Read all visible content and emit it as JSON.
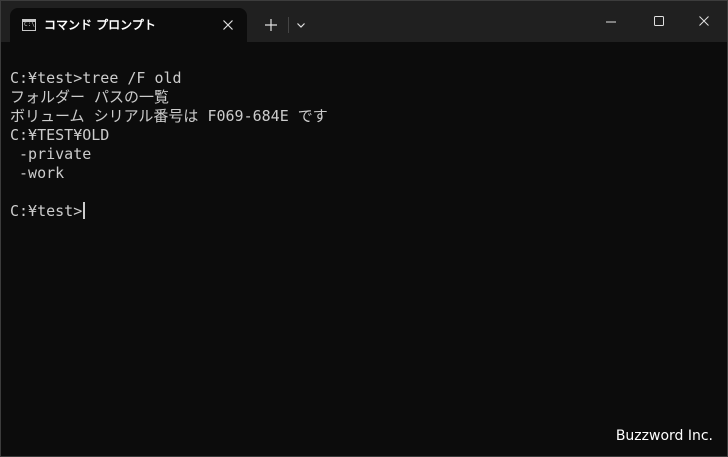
{
  "window": {
    "tab_title": "コマンド プロンプト",
    "icons": {
      "tab_icon": "command-prompt-icon",
      "tab_close": "close-icon",
      "new_tab": "plus-icon",
      "dropdown": "chevron-down-icon",
      "minimize": "minimize-icon",
      "maximize": "maximize-icon",
      "close": "close-icon"
    }
  },
  "terminal": {
    "lines": [
      "",
      "C:¥test>tree /F old",
      "フォルダー パスの一覧",
      "ボリューム シリアル番号は F069-684E です",
      "C:¥TEST¥OLD",
      " -private",
      " -work",
      ""
    ],
    "prompt": "C:¥test>"
  },
  "watermark": "Buzzword Inc.",
  "colors": {
    "titlebar": "#202020",
    "background": "#0c0c0c",
    "text": "#cccccc"
  }
}
